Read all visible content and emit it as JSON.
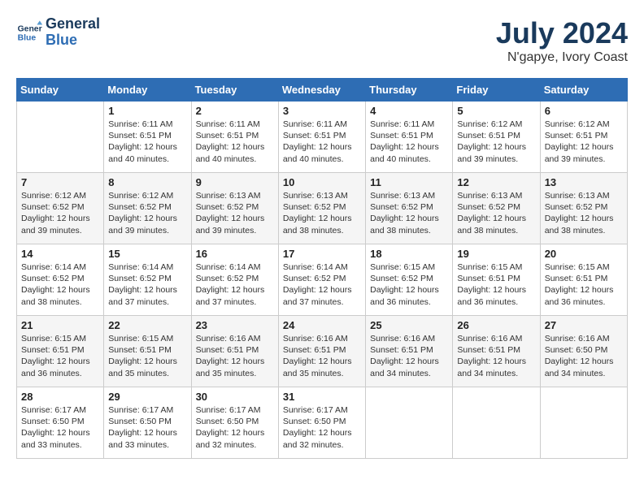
{
  "header": {
    "logo_line1": "General",
    "logo_line2": "Blue",
    "month": "July 2024",
    "location": "N'gapye, Ivory Coast"
  },
  "weekdays": [
    "Sunday",
    "Monday",
    "Tuesday",
    "Wednesday",
    "Thursday",
    "Friday",
    "Saturday"
  ],
  "weeks": [
    [
      {
        "day": "",
        "info": ""
      },
      {
        "day": "1",
        "info": "Sunrise: 6:11 AM\nSunset: 6:51 PM\nDaylight: 12 hours\nand 40 minutes."
      },
      {
        "day": "2",
        "info": "Sunrise: 6:11 AM\nSunset: 6:51 PM\nDaylight: 12 hours\nand 40 minutes."
      },
      {
        "day": "3",
        "info": "Sunrise: 6:11 AM\nSunset: 6:51 PM\nDaylight: 12 hours\nand 40 minutes."
      },
      {
        "day": "4",
        "info": "Sunrise: 6:11 AM\nSunset: 6:51 PM\nDaylight: 12 hours\nand 40 minutes."
      },
      {
        "day": "5",
        "info": "Sunrise: 6:12 AM\nSunset: 6:51 PM\nDaylight: 12 hours\nand 39 minutes."
      },
      {
        "day": "6",
        "info": "Sunrise: 6:12 AM\nSunset: 6:51 PM\nDaylight: 12 hours\nand 39 minutes."
      }
    ],
    [
      {
        "day": "7",
        "info": "Sunrise: 6:12 AM\nSunset: 6:52 PM\nDaylight: 12 hours\nand 39 minutes."
      },
      {
        "day": "8",
        "info": "Sunrise: 6:12 AM\nSunset: 6:52 PM\nDaylight: 12 hours\nand 39 minutes."
      },
      {
        "day": "9",
        "info": "Sunrise: 6:13 AM\nSunset: 6:52 PM\nDaylight: 12 hours\nand 39 minutes."
      },
      {
        "day": "10",
        "info": "Sunrise: 6:13 AM\nSunset: 6:52 PM\nDaylight: 12 hours\nand 38 minutes."
      },
      {
        "day": "11",
        "info": "Sunrise: 6:13 AM\nSunset: 6:52 PM\nDaylight: 12 hours\nand 38 minutes."
      },
      {
        "day": "12",
        "info": "Sunrise: 6:13 AM\nSunset: 6:52 PM\nDaylight: 12 hours\nand 38 minutes."
      },
      {
        "day": "13",
        "info": "Sunrise: 6:13 AM\nSunset: 6:52 PM\nDaylight: 12 hours\nand 38 minutes."
      }
    ],
    [
      {
        "day": "14",
        "info": "Sunrise: 6:14 AM\nSunset: 6:52 PM\nDaylight: 12 hours\nand 38 minutes."
      },
      {
        "day": "15",
        "info": "Sunrise: 6:14 AM\nSunset: 6:52 PM\nDaylight: 12 hours\nand 37 minutes."
      },
      {
        "day": "16",
        "info": "Sunrise: 6:14 AM\nSunset: 6:52 PM\nDaylight: 12 hours\nand 37 minutes."
      },
      {
        "day": "17",
        "info": "Sunrise: 6:14 AM\nSunset: 6:52 PM\nDaylight: 12 hours\nand 37 minutes."
      },
      {
        "day": "18",
        "info": "Sunrise: 6:15 AM\nSunset: 6:52 PM\nDaylight: 12 hours\nand 36 minutes."
      },
      {
        "day": "19",
        "info": "Sunrise: 6:15 AM\nSunset: 6:51 PM\nDaylight: 12 hours\nand 36 minutes."
      },
      {
        "day": "20",
        "info": "Sunrise: 6:15 AM\nSunset: 6:51 PM\nDaylight: 12 hours\nand 36 minutes."
      }
    ],
    [
      {
        "day": "21",
        "info": "Sunrise: 6:15 AM\nSunset: 6:51 PM\nDaylight: 12 hours\nand 36 minutes."
      },
      {
        "day": "22",
        "info": "Sunrise: 6:15 AM\nSunset: 6:51 PM\nDaylight: 12 hours\nand 35 minutes."
      },
      {
        "day": "23",
        "info": "Sunrise: 6:16 AM\nSunset: 6:51 PM\nDaylight: 12 hours\nand 35 minutes."
      },
      {
        "day": "24",
        "info": "Sunrise: 6:16 AM\nSunset: 6:51 PM\nDaylight: 12 hours\nand 35 minutes."
      },
      {
        "day": "25",
        "info": "Sunrise: 6:16 AM\nSunset: 6:51 PM\nDaylight: 12 hours\nand 34 minutes."
      },
      {
        "day": "26",
        "info": "Sunrise: 6:16 AM\nSunset: 6:51 PM\nDaylight: 12 hours\nand 34 minutes."
      },
      {
        "day": "27",
        "info": "Sunrise: 6:16 AM\nSunset: 6:50 PM\nDaylight: 12 hours\nand 34 minutes."
      }
    ],
    [
      {
        "day": "28",
        "info": "Sunrise: 6:17 AM\nSunset: 6:50 PM\nDaylight: 12 hours\nand 33 minutes."
      },
      {
        "day": "29",
        "info": "Sunrise: 6:17 AM\nSunset: 6:50 PM\nDaylight: 12 hours\nand 33 minutes."
      },
      {
        "day": "30",
        "info": "Sunrise: 6:17 AM\nSunset: 6:50 PM\nDaylight: 12 hours\nand 32 minutes."
      },
      {
        "day": "31",
        "info": "Sunrise: 6:17 AM\nSunset: 6:50 PM\nDaylight: 12 hours\nand 32 minutes."
      },
      {
        "day": "",
        "info": ""
      },
      {
        "day": "",
        "info": ""
      },
      {
        "day": "",
        "info": ""
      }
    ]
  ]
}
